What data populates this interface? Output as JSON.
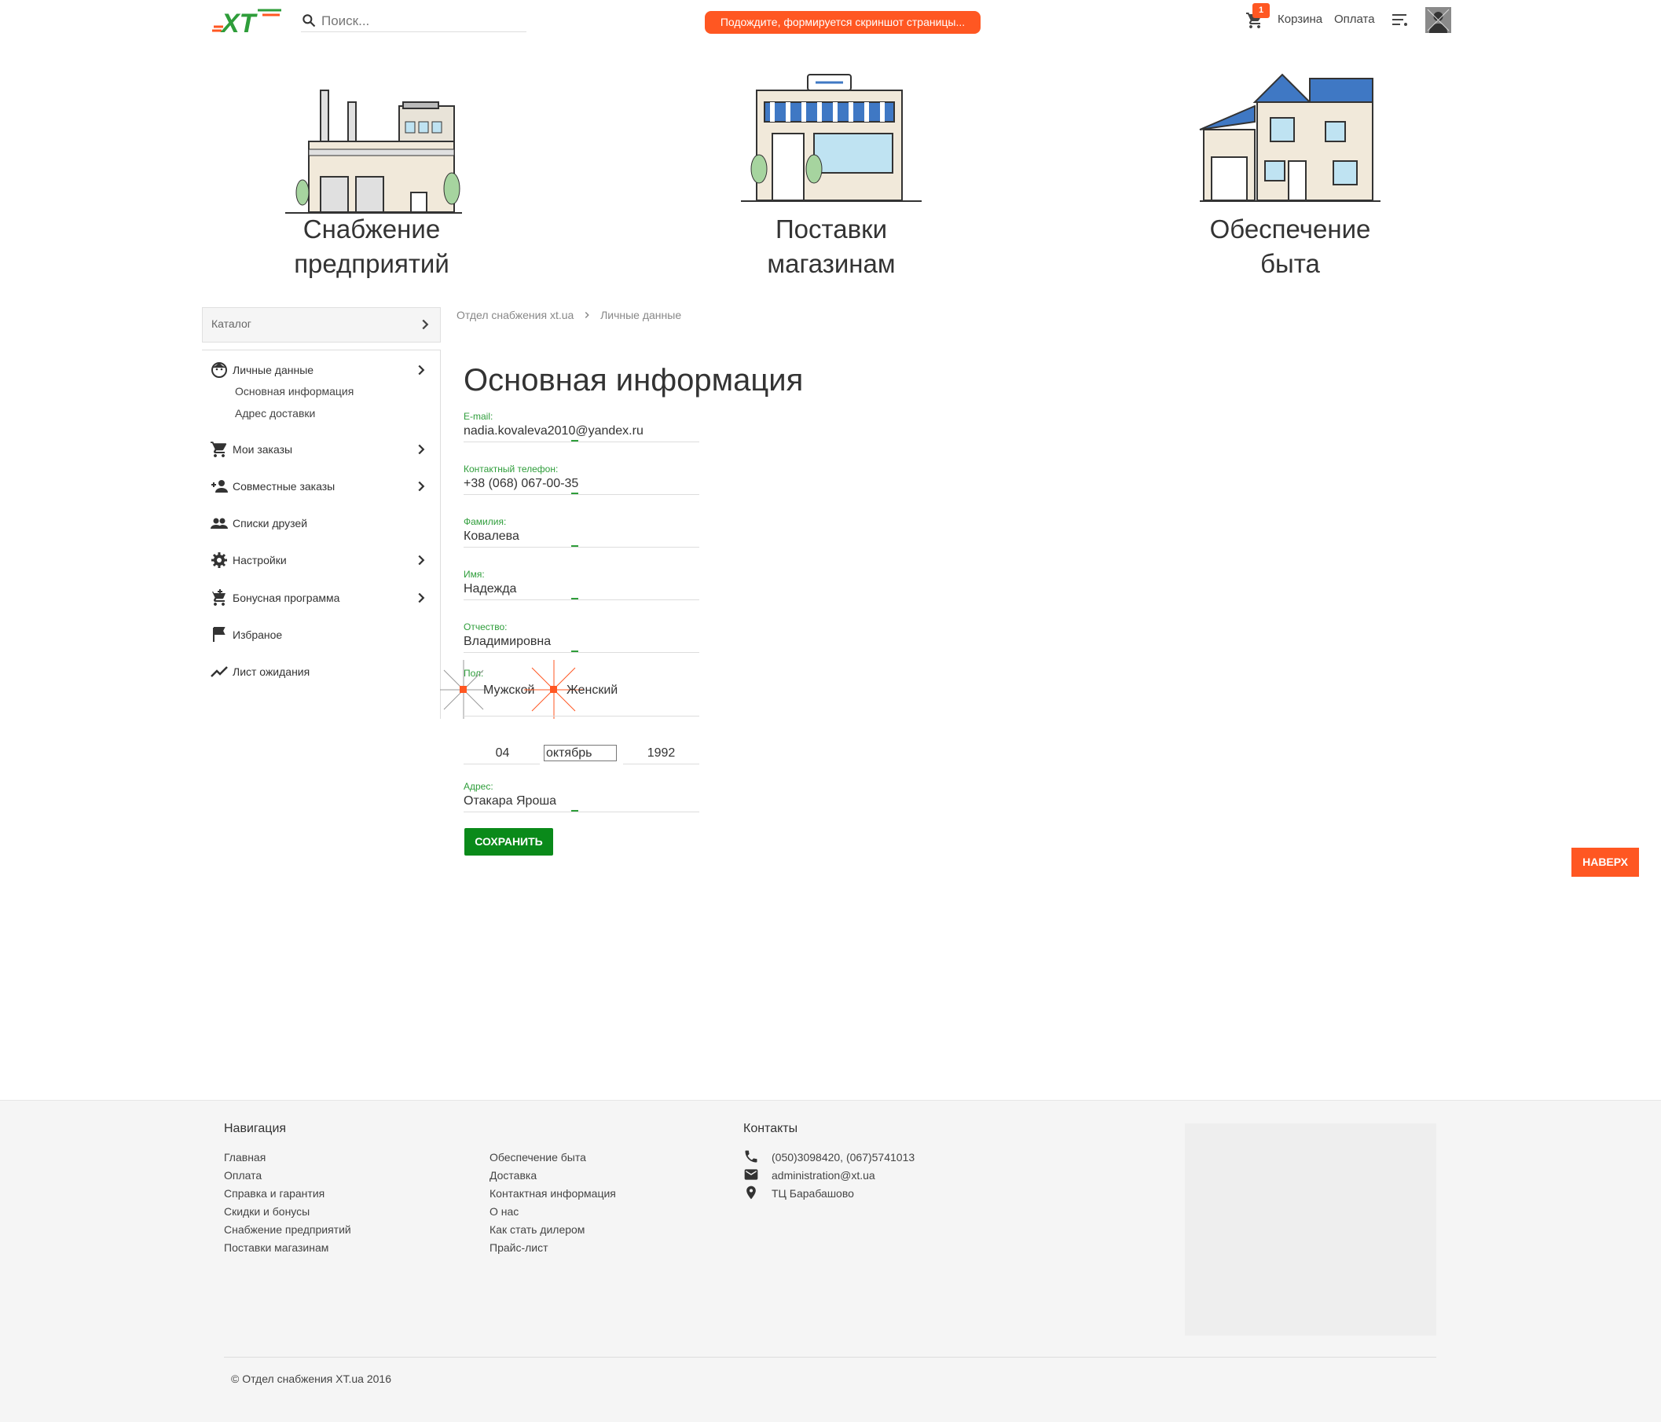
{
  "header": {
    "logo_text": "XT",
    "search_placeholder": "Поиск...",
    "notice": "Подождите, формируется скриншот страницы...",
    "cart_count": "1",
    "cart_label": "Корзина",
    "payment_label": "Оплата"
  },
  "categories": [
    {
      "line1": "Снабжение",
      "line2": "предприятий"
    },
    {
      "line1": "Поставки",
      "line2": "магазинам"
    },
    {
      "line1": "Обеспечение",
      "line2": "быта"
    }
  ],
  "sidebar": {
    "catalog_label": "Каталог",
    "items": [
      {
        "label": "Личные данные",
        "icon": "face-icon"
      },
      {
        "label": "Мои заказы",
        "icon": "cart-icon"
      },
      {
        "label": "Совместные заказы",
        "icon": "person-add-icon"
      },
      {
        "label": "Списки друзей",
        "icon": "people-icon"
      },
      {
        "label": "Настройки",
        "icon": "gear-icon"
      },
      {
        "label": "Бонусная программа",
        "icon": "add-cart-icon"
      },
      {
        "label": "Избраное",
        "icon": "flag-icon"
      },
      {
        "label": "Лист ожидания",
        "icon": "trending-icon"
      }
    ],
    "subitems": [
      "Основная информация",
      "Адрес доставки"
    ]
  },
  "breadcrumb": {
    "item1": "Отдел снабжения xt.ua",
    "item2": "Личные данные"
  },
  "form": {
    "title": "Основная информация",
    "email_label": "E-mail:",
    "email_value": "nadia.kovaleva2010@yandex.ru",
    "phone_label": "Контактный телефон:",
    "phone_value": "+38 (068) 067-00-35",
    "lastname_label": "Фамилия:",
    "lastname_value": "Ковалева",
    "firstname_label": "Имя:",
    "firstname_value": "Надежда",
    "middlename_label": "Отчество:",
    "middlename_value": "Владимировна",
    "gender_label": "Пол:",
    "gender_male": "Мужской",
    "gender_female": "Женский",
    "birth_day": "04",
    "birth_month": "октябрь",
    "birth_year": "1992",
    "address_label": "Адрес:",
    "address_value": "Отакара Яроша",
    "save_label": "СОХРАНИТЬ"
  },
  "to_top_label": "НАВЕРХ",
  "footer": {
    "nav_heading": "Навигация",
    "nav_col1": [
      "Главная",
      "Оплата",
      "Справка и гарантия",
      "Скидки и бонусы",
      "Снабжение предприятий",
      "Поставки магазинам"
    ],
    "nav_col2": [
      "Обеспечение быта",
      "Доставка",
      "Контактная информация",
      "О нас",
      "Как стать дилером",
      "Прайс-лист"
    ],
    "contacts_heading": "Контакты",
    "phone": "(050)3098420, (067)5741013",
    "email": "administration@xt.ua",
    "location": "ТЦ Барабашово",
    "copyright": "© Отдел снабжения XT.ua 2016"
  },
  "colors": {
    "accent": "#ff5722",
    "green": "#0a8a1a",
    "label_green": "#2e9d3a"
  }
}
